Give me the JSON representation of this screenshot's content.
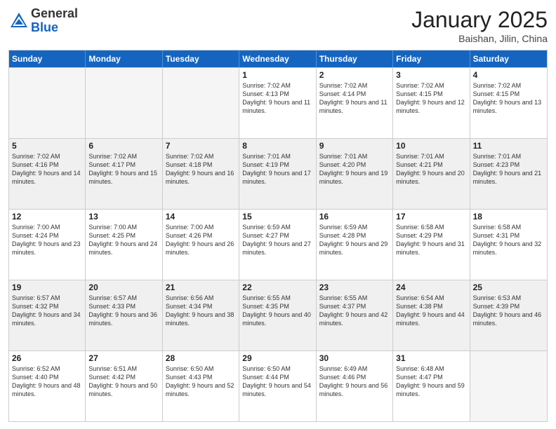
{
  "header": {
    "logo_general": "General",
    "logo_blue": "Blue",
    "month_title": "January 2025",
    "location": "Baishan, Jilin, China"
  },
  "weekdays": [
    "Sunday",
    "Monday",
    "Tuesday",
    "Wednesday",
    "Thursday",
    "Friday",
    "Saturday"
  ],
  "rows": [
    [
      {
        "day": "",
        "info": ""
      },
      {
        "day": "",
        "info": ""
      },
      {
        "day": "",
        "info": ""
      },
      {
        "day": "1",
        "info": "Sunrise: 7:02 AM\nSunset: 4:13 PM\nDaylight: 9 hours and 11 minutes."
      },
      {
        "day": "2",
        "info": "Sunrise: 7:02 AM\nSunset: 4:14 PM\nDaylight: 9 hours and 11 minutes."
      },
      {
        "day": "3",
        "info": "Sunrise: 7:02 AM\nSunset: 4:15 PM\nDaylight: 9 hours and 12 minutes."
      },
      {
        "day": "4",
        "info": "Sunrise: 7:02 AM\nSunset: 4:15 PM\nDaylight: 9 hours and 13 minutes."
      }
    ],
    [
      {
        "day": "5",
        "info": "Sunrise: 7:02 AM\nSunset: 4:16 PM\nDaylight: 9 hours and 14 minutes."
      },
      {
        "day": "6",
        "info": "Sunrise: 7:02 AM\nSunset: 4:17 PM\nDaylight: 9 hours and 15 minutes."
      },
      {
        "day": "7",
        "info": "Sunrise: 7:02 AM\nSunset: 4:18 PM\nDaylight: 9 hours and 16 minutes."
      },
      {
        "day": "8",
        "info": "Sunrise: 7:01 AM\nSunset: 4:19 PM\nDaylight: 9 hours and 17 minutes."
      },
      {
        "day": "9",
        "info": "Sunrise: 7:01 AM\nSunset: 4:20 PM\nDaylight: 9 hours and 19 minutes."
      },
      {
        "day": "10",
        "info": "Sunrise: 7:01 AM\nSunset: 4:21 PM\nDaylight: 9 hours and 20 minutes."
      },
      {
        "day": "11",
        "info": "Sunrise: 7:01 AM\nSunset: 4:23 PM\nDaylight: 9 hours and 21 minutes."
      }
    ],
    [
      {
        "day": "12",
        "info": "Sunrise: 7:00 AM\nSunset: 4:24 PM\nDaylight: 9 hours and 23 minutes."
      },
      {
        "day": "13",
        "info": "Sunrise: 7:00 AM\nSunset: 4:25 PM\nDaylight: 9 hours and 24 minutes."
      },
      {
        "day": "14",
        "info": "Sunrise: 7:00 AM\nSunset: 4:26 PM\nDaylight: 9 hours and 26 minutes."
      },
      {
        "day": "15",
        "info": "Sunrise: 6:59 AM\nSunset: 4:27 PM\nDaylight: 9 hours and 27 minutes."
      },
      {
        "day": "16",
        "info": "Sunrise: 6:59 AM\nSunset: 4:28 PM\nDaylight: 9 hours and 29 minutes."
      },
      {
        "day": "17",
        "info": "Sunrise: 6:58 AM\nSunset: 4:29 PM\nDaylight: 9 hours and 31 minutes."
      },
      {
        "day": "18",
        "info": "Sunrise: 6:58 AM\nSunset: 4:31 PM\nDaylight: 9 hours and 32 minutes."
      }
    ],
    [
      {
        "day": "19",
        "info": "Sunrise: 6:57 AM\nSunset: 4:32 PM\nDaylight: 9 hours and 34 minutes."
      },
      {
        "day": "20",
        "info": "Sunrise: 6:57 AM\nSunset: 4:33 PM\nDaylight: 9 hours and 36 minutes."
      },
      {
        "day": "21",
        "info": "Sunrise: 6:56 AM\nSunset: 4:34 PM\nDaylight: 9 hours and 38 minutes."
      },
      {
        "day": "22",
        "info": "Sunrise: 6:55 AM\nSunset: 4:35 PM\nDaylight: 9 hours and 40 minutes."
      },
      {
        "day": "23",
        "info": "Sunrise: 6:55 AM\nSunset: 4:37 PM\nDaylight: 9 hours and 42 minutes."
      },
      {
        "day": "24",
        "info": "Sunrise: 6:54 AM\nSunset: 4:38 PM\nDaylight: 9 hours and 44 minutes."
      },
      {
        "day": "25",
        "info": "Sunrise: 6:53 AM\nSunset: 4:39 PM\nDaylight: 9 hours and 46 minutes."
      }
    ],
    [
      {
        "day": "26",
        "info": "Sunrise: 6:52 AM\nSunset: 4:40 PM\nDaylight: 9 hours and 48 minutes."
      },
      {
        "day": "27",
        "info": "Sunrise: 6:51 AM\nSunset: 4:42 PM\nDaylight: 9 hours and 50 minutes."
      },
      {
        "day": "28",
        "info": "Sunrise: 6:50 AM\nSunset: 4:43 PM\nDaylight: 9 hours and 52 minutes."
      },
      {
        "day": "29",
        "info": "Sunrise: 6:50 AM\nSunset: 4:44 PM\nDaylight: 9 hours and 54 minutes."
      },
      {
        "day": "30",
        "info": "Sunrise: 6:49 AM\nSunset: 4:46 PM\nDaylight: 9 hours and 56 minutes."
      },
      {
        "day": "31",
        "info": "Sunrise: 6:48 AM\nSunset: 4:47 PM\nDaylight: 9 hours and 59 minutes."
      },
      {
        "day": "",
        "info": ""
      }
    ]
  ]
}
